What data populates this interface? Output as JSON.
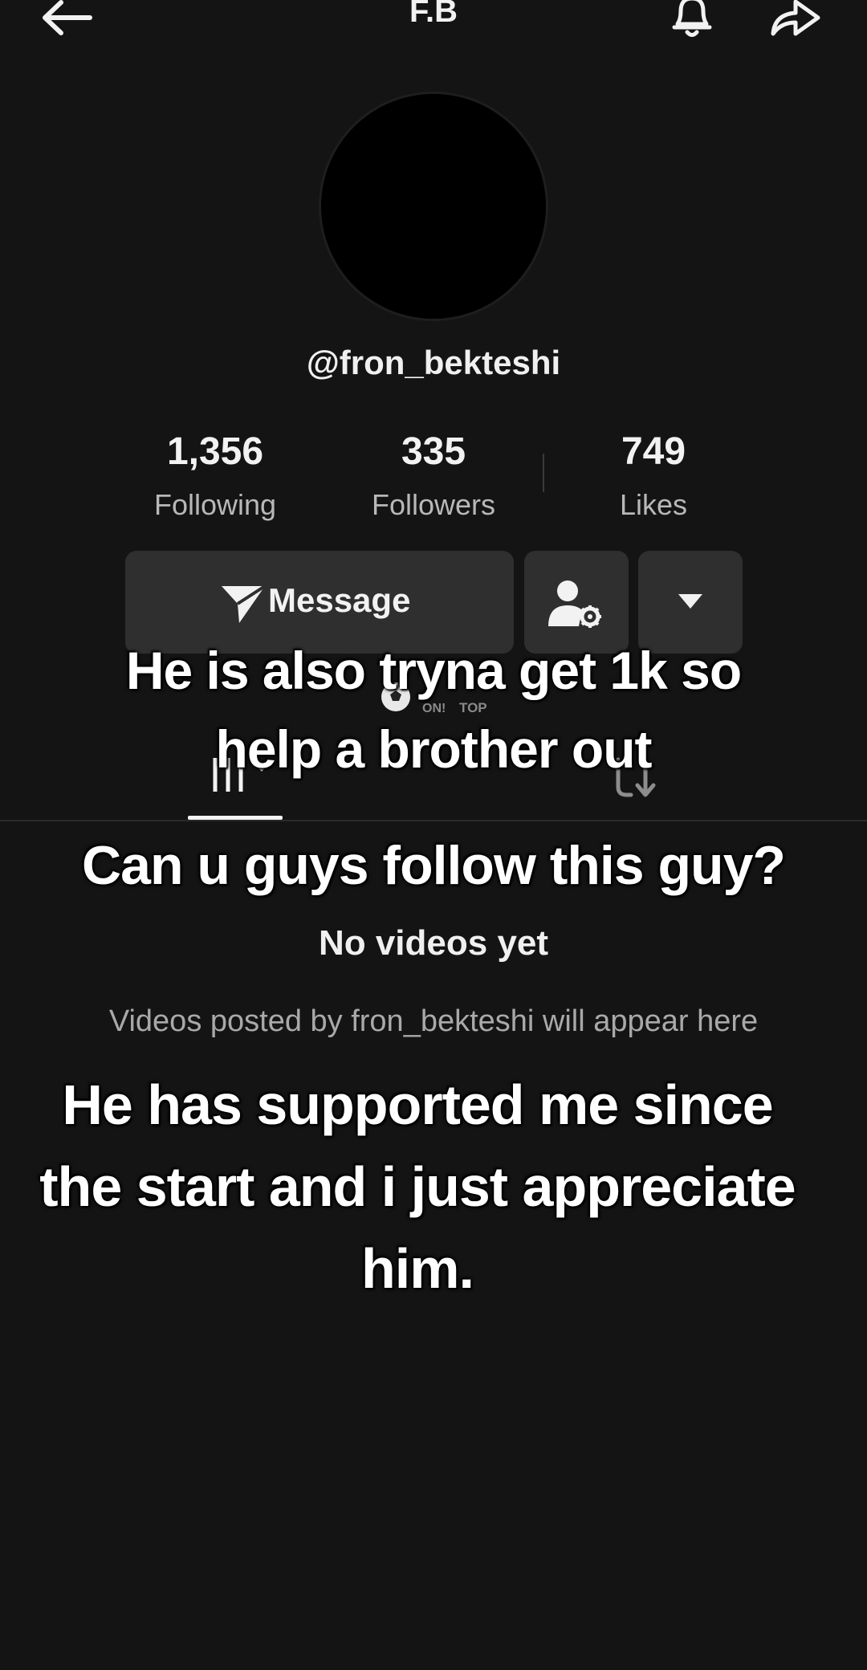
{
  "header": {
    "title": "F.B",
    "back_icon": "back-arrow-icon",
    "bell_icon": "bell-icon",
    "share_icon": "share-icon"
  },
  "profile": {
    "handle": "@fron_bekteshi"
  },
  "stats": [
    {
      "value": "1,356",
      "label": "Following"
    },
    {
      "value": "335",
      "label": "Followers"
    },
    {
      "value": "749",
      "label": "Likes"
    }
  ],
  "actions": {
    "message_label": "Message",
    "message_icon": "send-icon",
    "follow_settings_icon": "user-settings-icon",
    "more_icon": "dropdown-triangle-icon"
  },
  "badge": {
    "ball_icon": "soccer-ball-icon",
    "text_on": "ON!",
    "text_top": "TOP"
  },
  "tabs": {
    "videos_icon": "videos-grid-icon",
    "reposts_icon": "repost-icon"
  },
  "empty_state": {
    "title": "No videos yet",
    "subtitle": "Videos posted by fron_bekteshi will appear here"
  },
  "captions": [
    "He is also tryna get 1k so help a brother out",
    "Can u guys follow this guy?",
    "He has supported me since the start and i just appreciate him."
  ]
}
